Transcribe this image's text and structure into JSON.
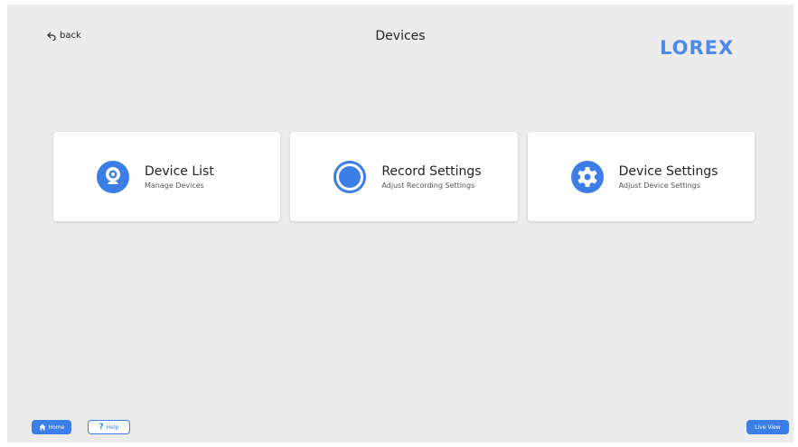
{
  "header": {
    "back_label": "back",
    "title": "Devices",
    "logo_text": "LOREX"
  },
  "cards": [
    {
      "title": "Device List",
      "subtitle": "Manage Devices",
      "icon": "camera-icon"
    },
    {
      "title": "Record Settings",
      "subtitle": "Adjust Recording Settings",
      "icon": "record-icon"
    },
    {
      "title": "Device Settings",
      "subtitle": "Adjust Device Settings",
      "icon": "gear-icon"
    }
  ],
  "footer": {
    "home_label": "Home",
    "help_label": "Help",
    "help_glyph": "?",
    "live_view_label": "Live View"
  },
  "colors": {
    "accent": "#3b7ee5",
    "logo": "#4b8ae9",
    "background": "#ececec",
    "card": "#ffffff"
  }
}
